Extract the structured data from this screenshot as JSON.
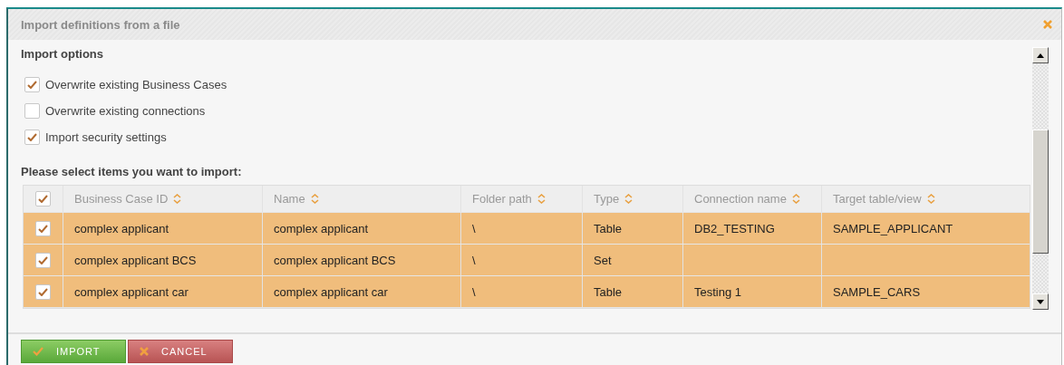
{
  "dialog": {
    "title": "Import definitions from a file"
  },
  "import_options": {
    "heading": "Import options",
    "options": [
      {
        "label": "Overwrite existing Business Cases",
        "checked": true
      },
      {
        "label": "Overwrite existing connections",
        "checked": false
      },
      {
        "label": "Import security settings",
        "checked": true
      }
    ]
  },
  "items": {
    "heading": "Please select items you want to import:",
    "all_checked": true,
    "columns": [
      "Business Case ID",
      "Name",
      "Folder path",
      "Type",
      "Connection name",
      "Target table/view"
    ],
    "rows": [
      {
        "checked": true,
        "selected": true,
        "cells": [
          "complex applicant",
          "complex applicant",
          "\\",
          "Table",
          "DB2_TESTING",
          "SAMPLE_APPLICANT"
        ]
      },
      {
        "checked": true,
        "selected": true,
        "cells": [
          "complex applicant BCS",
          "complex applicant BCS",
          "\\",
          "Set",
          "",
          ""
        ]
      },
      {
        "checked": true,
        "selected": true,
        "cells": [
          "complex applicant car",
          "complex applicant car",
          "\\",
          "Table",
          "Testing 1",
          "SAMPLE_CARS"
        ]
      }
    ]
  },
  "buttons": [
    {
      "kind": "import",
      "label": "IMPORT"
    },
    {
      "kind": "cancel",
      "label": "CANCEL"
    }
  ]
}
